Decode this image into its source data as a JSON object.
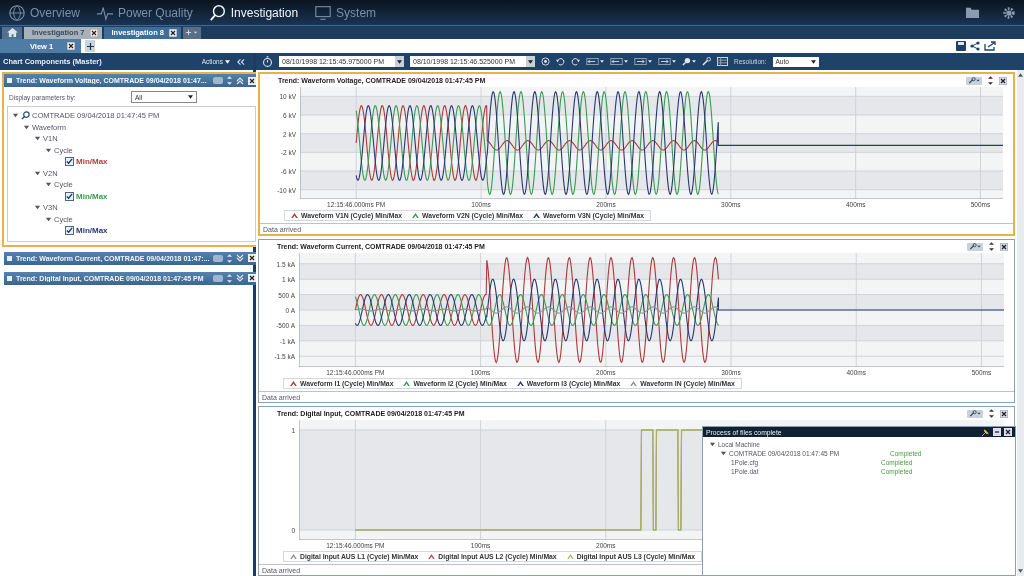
{
  "nav": {
    "items": [
      {
        "label": "Overview",
        "selected": false,
        "kind": "globe"
      },
      {
        "label": "Power Quality",
        "selected": false,
        "kind": "wave"
      },
      {
        "label": "Investigation",
        "selected": true,
        "kind": "search"
      },
      {
        "label": "System",
        "selected": false,
        "kind": "monitor"
      }
    ]
  },
  "doc_tabs": [
    {
      "label": "Investigation 7",
      "selected": false
    },
    {
      "label": "Investigation 8",
      "selected": true
    }
  ],
  "view_tabs": [
    {
      "label": "View 1",
      "selected": true
    }
  ],
  "left_panel": {
    "title": "Chart Components (Master)",
    "actions": "Actions",
    "sections": [
      {
        "title": "Trend: Waveform Voltage, COMTRADE 09/04/2018 01:47...",
        "expanded": true,
        "selected": true,
        "display_label": "Display parameters by:",
        "display_value": "All",
        "tree": [
          {
            "label": "COMTRADE 09/04/2018 01:47:45 PM",
            "expanded": true,
            "children": [
              {
                "label": "Waveform",
                "expanded": true,
                "children": [
                  {
                    "label": "V1N",
                    "expanded": true,
                    "children": [
                      {
                        "label": "Cycle",
                        "expanded": true,
                        "children": [
                          {
                            "label": "Min/Max",
                            "checked": true,
                            "color": "#b04040"
                          }
                        ]
                      }
                    ]
                  },
                  {
                    "label": "V2N",
                    "expanded": true,
                    "children": [
                      {
                        "label": "Cycle",
                        "expanded": true,
                        "children": [
                          {
                            "label": "Min/Max",
                            "checked": true,
                            "color": "#3a9a4a"
                          }
                        ]
                      }
                    ]
                  },
                  {
                    "label": "V3N",
                    "expanded": true,
                    "children": [
                      {
                        "label": "Cycle",
                        "expanded": true,
                        "children": [
                          {
                            "label": "Min/Max",
                            "checked": true,
                            "color": "#2a3a7a"
                          }
                        ]
                      }
                    ]
                  }
                ]
              }
            ]
          }
        ]
      },
      {
        "title": "Trend: Waveform Current, COMTRADE 09/04/2018 01:47:...",
        "expanded": false,
        "selected": false
      },
      {
        "title": "Trend: Digital Input, COMTRADE 09/04/2018 01:47:45 PM",
        "expanded": false,
        "selected": false
      }
    ]
  },
  "toolbar": {
    "start": "08/10/1998 12:15:45.975000 PM",
    "end": "08/10/1998 12:15:46.525000 PM",
    "resolution_label": "Resolution:",
    "resolution": "Auto"
  },
  "charts": [
    {
      "kind": "voltage",
      "title": "Trend: Waveform Voltage, COMTRADE 09/04/2018 01:47:45 PM",
      "selected": true,
      "y_ticks": [
        "10 kV",
        "6 kV",
        "2 kV",
        "-2 kV",
        "-6 kV",
        "-10 kV"
      ],
      "x_ticks": [
        "12:15:46.000ms PM",
        "100ms",
        "200ms",
        "300ms",
        "400ms",
        "500ms"
      ],
      "legend": [
        {
          "label": "Waveform V1N (Cycle) Min/Max",
          "color": "#b03838"
        },
        {
          "label": "Waveform V2N (Cycle) Min/Max",
          "color": "#3c9a50"
        },
        {
          "label": "Waveform V3N (Cycle) Min/Max",
          "color": "#283870"
        }
      ],
      "status": "Data arrived"
    },
    {
      "kind": "current",
      "title": "Trend: Waveform Current, COMTRADE 09/04/2018 01:47:45 PM",
      "selected": false,
      "y_ticks": [
        "1.5 kA",
        "1 kA",
        "500 A",
        "0 A",
        "-500 A",
        "-1 kA",
        "-1.5 kA"
      ],
      "x_ticks": [
        "12:15:46.000ms PM",
        "100ms",
        "200ms",
        "300ms",
        "400ms",
        "500ms"
      ],
      "legend": [
        {
          "label": "Waveform I1 (Cycle) Min/Max",
          "color": "#b03838"
        },
        {
          "label": "Waveform I2 (Cycle) Min/Max",
          "color": "#3c9a50"
        },
        {
          "label": "Waveform I3 (Cycle) Min/Max",
          "color": "#283870"
        },
        {
          "label": "Waveform IN (Cycle) Min/Max",
          "color": "#909090"
        }
      ],
      "status": "Data arrived"
    },
    {
      "kind": "digital",
      "title": "Trend: Digital Input, COMTRADE 09/04/2018 01:47:45 PM",
      "selected": false,
      "y_ticks": [
        "1",
        "0"
      ],
      "x_ticks": [
        "12:15:46.000ms PM",
        "100ms",
        "200ms"
      ],
      "legend": [
        {
          "label": "Digital Input AUS L1 (Cycle) Min/Max",
          "color": "#8a9a8a"
        },
        {
          "label": "Digital Input AUS L2 (Cycle) Min/Max",
          "color": "#c05050"
        },
        {
          "label": "Digital Input AUS L3 (Cycle) Min/Max",
          "color": "#b0b870"
        }
      ],
      "status": "Data arrived"
    }
  ],
  "popup": {
    "title": "Process of files complete",
    "tree": [
      {
        "label": "Local Machine",
        "expanded": true,
        "children": [
          {
            "label": "COMTRADE 09/04/2018 01:47:45 PM",
            "status": "Completed",
            "expanded": true,
            "children": [
              {
                "label": "1Pole.cfg",
                "status": "Completed"
              },
              {
                "label": "1Pole.dat",
                "status": "Completed"
              }
            ]
          }
        ]
      }
    ]
  }
}
